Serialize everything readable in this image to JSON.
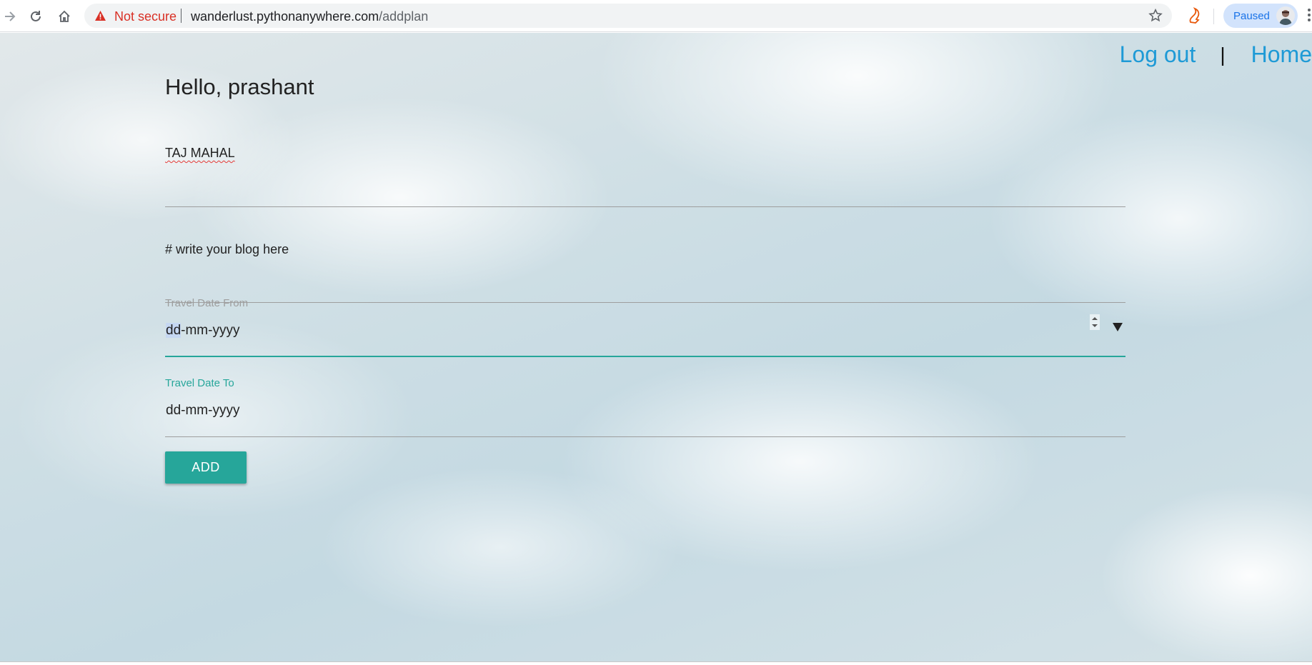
{
  "browser": {
    "security_label": "Not secure",
    "url_host": "wanderlust.pythonanywhere.com",
    "url_path": "/addplan",
    "profile_label": "Paused"
  },
  "nav": {
    "logout": "Log out",
    "separator": "|",
    "home": "Home"
  },
  "greeting": "Hello, prashant",
  "form": {
    "title_value": "TAJ MAHAL",
    "blog_value": "# write your blog here",
    "date_from": {
      "label": "Travel Date From",
      "value_selected": "dd",
      "value_rest": "-mm-yyyy"
    },
    "date_to": {
      "label": "Travel Date To",
      "value": "dd-mm-yyyy"
    },
    "submit": "ADD"
  },
  "colors": {
    "accent": "#26a69a",
    "link": "#1e9ad6",
    "warning": "#d93025"
  }
}
